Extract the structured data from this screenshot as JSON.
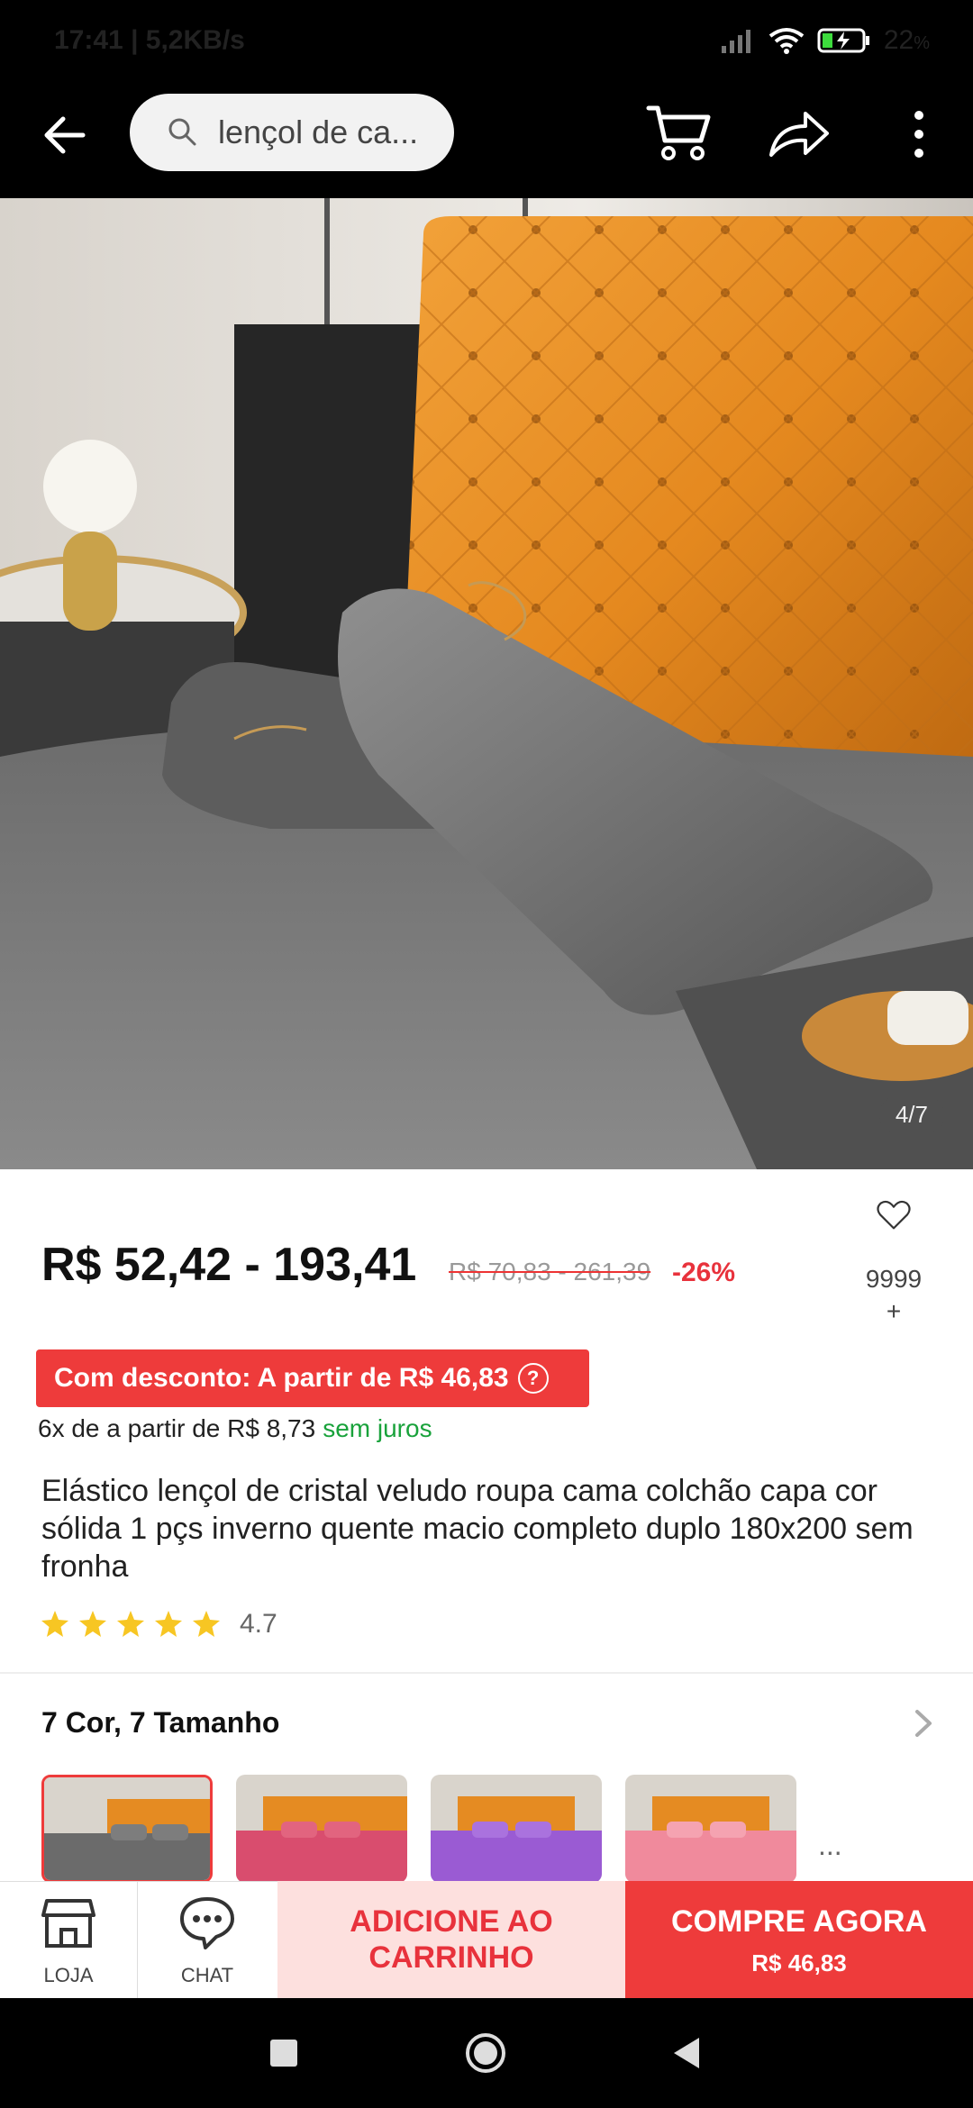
{
  "status_bar": {
    "time_speed": "17:41 | 5,2KB/s",
    "battery": "22",
    "battery_unit": "%"
  },
  "search": {
    "query": "lençol de ca..."
  },
  "image": {
    "counter": "4/7"
  },
  "price": {
    "range": "R$ 52,42 - 193,41",
    "original_range": "R$ 70,83 - 261,39",
    "discount": "-26%"
  },
  "favorites": {
    "count": "9999",
    "plus": "+"
  },
  "discount_banner": {
    "text": "Com desconto: A partir de R$ 46,83",
    "help": "?"
  },
  "installments": {
    "text": "6x de a partir de R$ 8,73",
    "free": "sem juros"
  },
  "product": {
    "title": "Elástico lençol de cristal veludo roupa cama colchão capa cor sólida 1 pçs inverno quente macio completo duplo 180x200 sem fronha",
    "rating": 4.7,
    "rating_label": "4.7"
  },
  "variations": {
    "title": "7 Cor, 7 Tamanho",
    "more": "...",
    "thumbnails": [
      {
        "sheet_color": "#6b6b6b"
      },
      {
        "sheet_color": "#d94d6e"
      },
      {
        "sheet_color": "#9a5bd3"
      },
      {
        "sheet_color": "#f08a9c"
      }
    ]
  },
  "bottom_bar": {
    "store_label": "LOJA",
    "chat_label": "CHAT",
    "add_to_cart": "ADICIONE AO CARRINHO",
    "buy_now": "COMPRE AGORA",
    "buy_now_price": "R$ 46,83"
  },
  "colors": {
    "accent": "#ee3b3b",
    "price_green": "#19a23b",
    "star": "#f7c623"
  }
}
